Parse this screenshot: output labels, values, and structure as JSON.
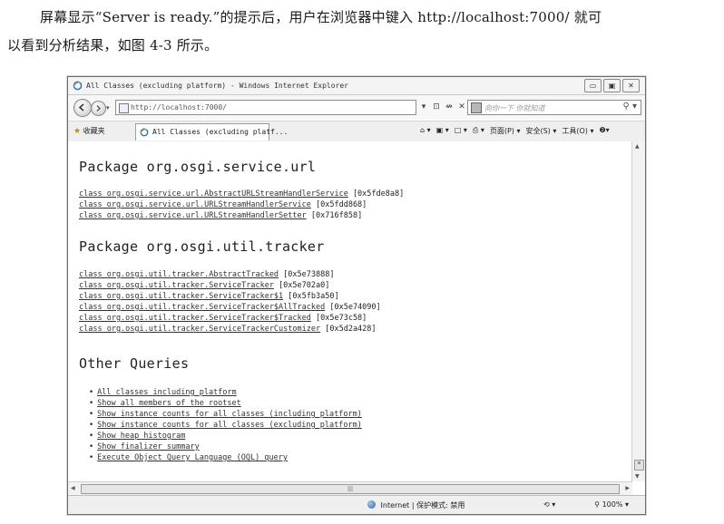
{
  "paragraph": {
    "line1": "屏幕显示“Server is ready.”的提示后，用户在浏览器中键入 http://localhost:7000/ 就可",
    "line2": "以看到分析结果，如图 4-3 所示。"
  },
  "browser": {
    "window_title": "All Classes (excluding platform) - Windows Internet Explorer",
    "window_buttons": [
      "▭",
      "▣",
      "✕"
    ],
    "address_url": "http://localhost:7000/",
    "address_controls": [
      "▾",
      "⊡",
      "↮",
      "✕"
    ],
    "search_placeholder": "向你一下  你就知道",
    "search_icon": "magnifier-icon",
    "favorites_label": "收藏夹",
    "tab_title": "All Classes (excluding platf...",
    "commands": [
      "⌂ ▾",
      "▣ ▾",
      "□ ▾",
      "⎙ ▾",
      "页面(P) ▾",
      "安全(S) ▾",
      "工具(O) ▾",
      "❷▾"
    ],
    "status_zone": "Internet | 保护模式: 禁用",
    "zoom_controls": "⟲ ▾",
    "zoom_level": "100%"
  },
  "content": {
    "section1": {
      "heading": "Package org.osgi.service.url",
      "items": [
        {
          "name": "class org.osgi.service.url.AbstractURLStreamHandlerService",
          "addr": "[0x5fde8a8]"
        },
        {
          "name": "class org.osgi.service.url.URLStreamHandlerService",
          "addr": "[0x5fdd868]"
        },
        {
          "name": "class org.osgi.service.url.URLStreamHandlerSetter",
          "addr": "[0x716f858]"
        }
      ]
    },
    "section2": {
      "heading": "Package org.osgi.util.tracker",
      "items": [
        {
          "name": "class org.osgi.util.tracker.AbstractTracked",
          "addr": "[0x5e73888]"
        },
        {
          "name": "class org.osgi.util.tracker.ServiceTracker",
          "addr": "[0x5e702a0]"
        },
        {
          "name": "class org.osgi.util.tracker.ServiceTracker$1",
          "addr": "[0x5fb3a50]"
        },
        {
          "name": "class org.osgi.util.tracker.ServiceTracker$AllTracked",
          "addr": "[0x5e74090]"
        },
        {
          "name": "class org.osgi.util.tracker.ServiceTracker$Tracked",
          "addr": "[0x5e73c58]"
        },
        {
          "name": "class org.osgi.util.tracker.ServiceTrackerCustomizer",
          "addr": "[0x5d2a428]"
        }
      ]
    },
    "section3": {
      "heading": "Other Queries",
      "items": [
        "All classes including platform",
        "Show all members of the rootset",
        "Show instance counts for all classes (including platform)",
        "Show instance counts for all classes (excluding platform)",
        "Show heap histogram",
        "Show finalizer summary",
        "Execute Object Query Language (OQL) query"
      ]
    }
  }
}
